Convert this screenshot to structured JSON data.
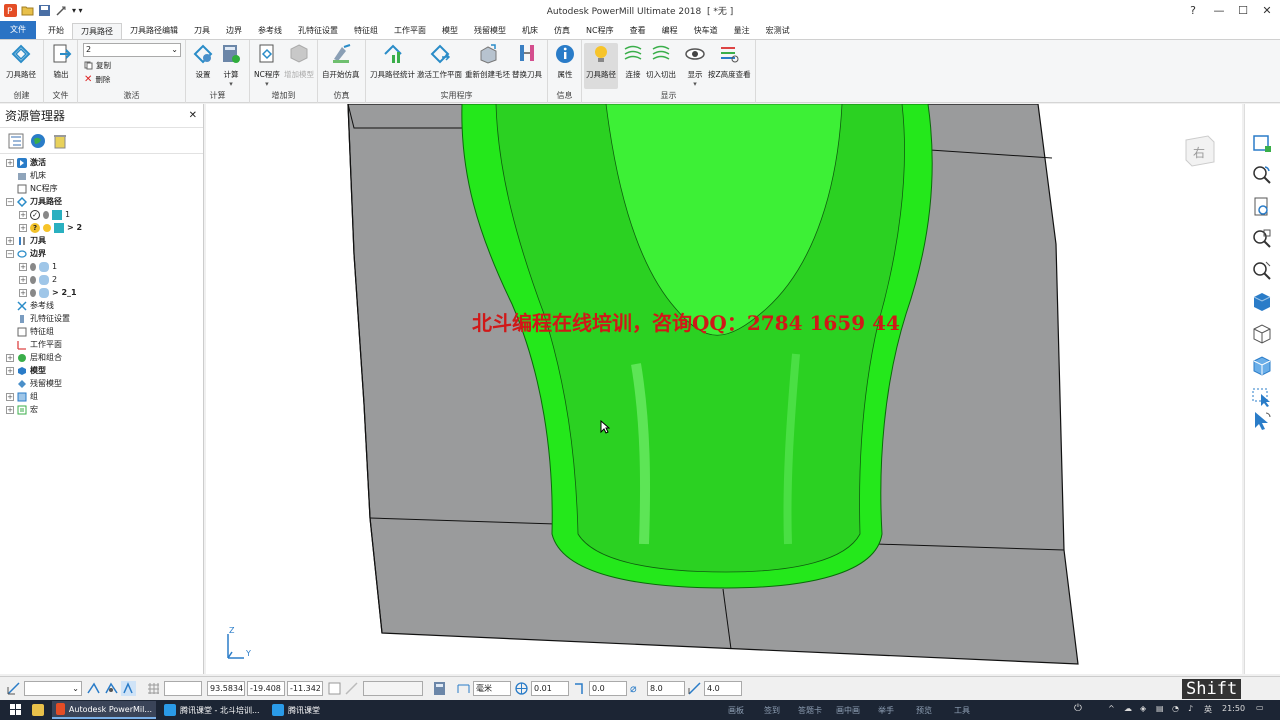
{
  "window": {
    "title": "Autodesk PowerMill Ultimate 2018",
    "doc": "[ *无 ]"
  },
  "tabs": [
    "文件",
    "开始",
    "刀具路径",
    "刀具路径编辑",
    "刀具",
    "边界",
    "参考线",
    "孔特征设置",
    "特征组",
    "工作平面",
    "模型",
    "残留模型",
    "机床",
    "仿真",
    "NC程序",
    "查看",
    "编程",
    "快车道",
    "量注",
    "宏测试"
  ],
  "ribbon": {
    "create": {
      "group": "创建",
      "btn": "刀具路径"
    },
    "file": {
      "group": "文件",
      "btn": "输出"
    },
    "activate": {
      "group": "激活",
      "select_value": "2",
      "copy": "复制",
      "delete": "删除"
    },
    "calc": {
      "group": "计算",
      "setup": "设置",
      "compute": "计算"
    },
    "add": {
      "group": "增加到",
      "nc": "NC程序",
      "ref": "增加模型"
    },
    "sim": {
      "group": "仿真",
      "start": "自开始仿真"
    },
    "util": {
      "group": "实用程序",
      "stats": "刀具路径统计",
      "activate_wp": "激活工作平面",
      "rebuild_block": "重新创建毛坯",
      "replace_tool": "替换刀具"
    },
    "info": {
      "group": "信息",
      "props": "属性"
    },
    "display": {
      "group": "显示",
      "toolpath": "刀具路径",
      "links": "连接",
      "leads": "切入切出",
      "show": "显示",
      "zheight": "按Z高度查看"
    }
  },
  "explorer": {
    "title": "资源管理器",
    "items": [
      {
        "label": "激活",
        "bold": true
      },
      {
        "label": "机床"
      },
      {
        "label": "NC程序"
      },
      {
        "label": "刀具路径",
        "bold": true
      },
      {
        "label": "1"
      },
      {
        "label": "> 2",
        "bold": true
      },
      {
        "label": "刀具",
        "bold": true
      },
      {
        "label": "边界",
        "bold": true
      },
      {
        "label": "1"
      },
      {
        "label": "2"
      },
      {
        "label": "> 2_1",
        "bold": true
      },
      {
        "label": "参考线"
      },
      {
        "label": "孔特征设置"
      },
      {
        "label": "特征组"
      },
      {
        "label": "工作平面"
      },
      {
        "label": "层和组合"
      },
      {
        "label": "模型"
      },
      {
        "label": "残留模型"
      },
      {
        "label": "组"
      },
      {
        "label": "宏"
      }
    ]
  },
  "viewport": {
    "watermark": "北斗编程在线培训，咨询QQ：2784 1659 44",
    "viewcube_label": "右",
    "axis_z": "Z",
    "axis_y": "Y",
    "colors": {
      "toolpath": "#22e81a",
      "background": "#ffffff",
      "model": "#999a9a"
    }
  },
  "status": {
    "x": "93.5834",
    "y": "-19.408",
    "z": "-11.342",
    "units": "毫米",
    "tol": "0.01",
    "thick": "0.0",
    "diam": "8.0",
    "step": "4.0",
    "shift": "Shift"
  },
  "taskbar": {
    "apps": [
      "Autodesk PowerMil...",
      "腾讯课堂 - 北斗培训...",
      "腾讯课堂"
    ],
    "tray": [
      "画板",
      "签到",
      "答题卡",
      "画中画",
      "举手",
      "预览",
      "工具"
    ],
    "ime": "英",
    "time": "21:50"
  }
}
